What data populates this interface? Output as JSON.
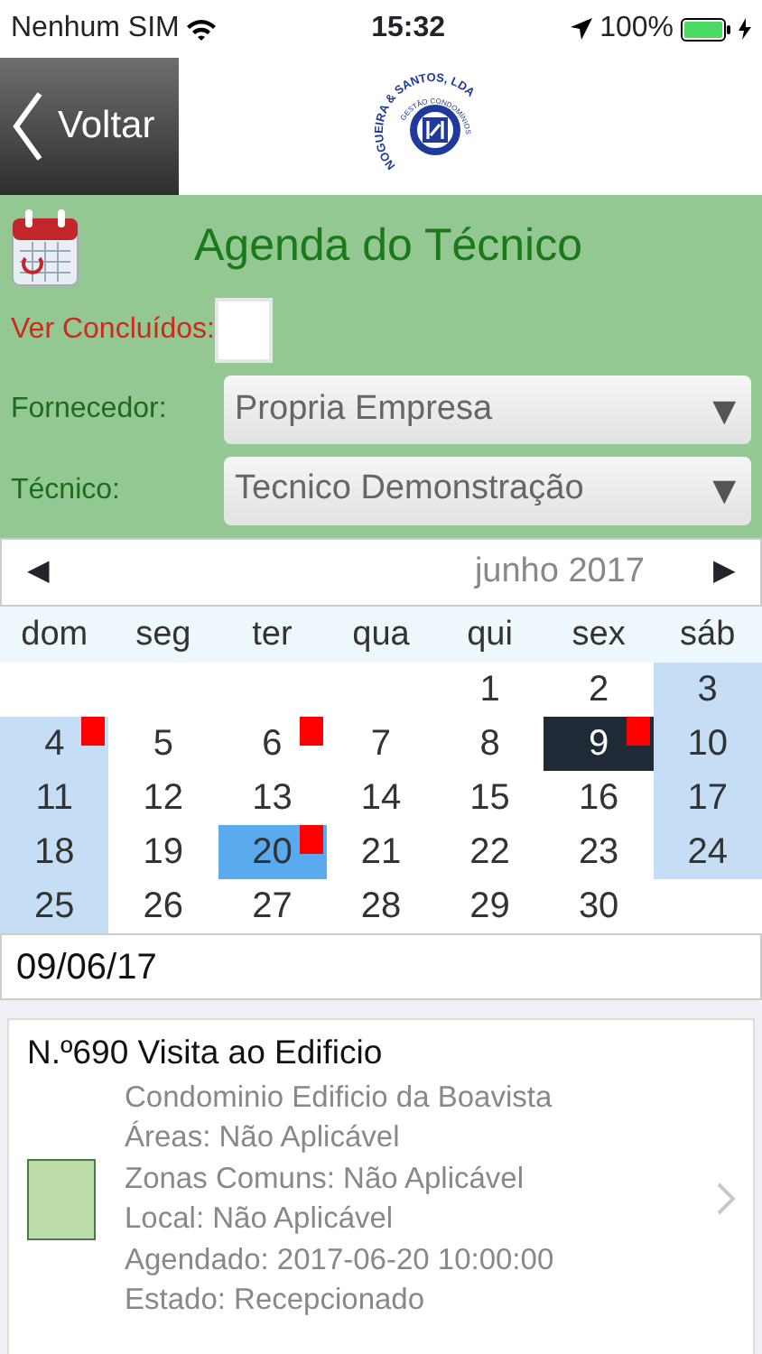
{
  "status_bar": {
    "carrier": "Nenhum SIM",
    "time": "15:32",
    "battery": "100%"
  },
  "header": {
    "back": "Voltar",
    "logo": {
      "name": "NOGUEIRA & SANTOS, LDA",
      "tagline": "GESTÃO CONDOMÍNIOS"
    }
  },
  "filters": {
    "title": "Agenda do Técnico",
    "show_done": {
      "label": "Ver Concluídos:",
      "checked": false
    },
    "selects": [
      {
        "label": "Fornecedor:",
        "value": "Propria Empresa",
        "arrow": "▼"
      },
      {
        "label": "Técnico:",
        "value": "Tecnico Demonstração",
        "arrow": "▼"
      }
    ]
  },
  "calendar": {
    "prev": "◀",
    "month": "junho 2017",
    "next": "▶",
    "weekdays": [
      "dom",
      "seg",
      "ter",
      "qua",
      "qui",
      "sex",
      "sáb"
    ],
    "weeks": [
      [
        {
          "kind": "blank"
        },
        {
          "kind": "blank"
        },
        {
          "kind": "blank"
        },
        {
          "kind": "blank"
        },
        {
          "day": "1",
          "selected": false,
          "today": false,
          "event": false
        },
        {
          "day": "2",
          "selected": false,
          "today": false,
          "event": false
        },
        {
          "day": "3",
          "selected": false,
          "today": false,
          "event": false
        }
      ],
      [
        {
          "day": "4",
          "selected": false,
          "today": false,
          "event": true
        },
        {
          "day": "5",
          "selected": false,
          "today": false,
          "event": false
        },
        {
          "day": "6",
          "selected": false,
          "today": false,
          "event": true
        },
        {
          "day": "7",
          "selected": false,
          "today": false,
          "event": false
        },
        {
          "day": "8",
          "selected": false,
          "today": false,
          "event": false
        },
        {
          "day": "9",
          "selected": true,
          "today": false,
          "event": true
        },
        {
          "day": "10",
          "selected": false,
          "today": false,
          "event": false
        }
      ],
      [
        {
          "day": "11",
          "selected": false,
          "today": false,
          "event": false
        },
        {
          "day": "12",
          "selected": false,
          "today": false,
          "event": false
        },
        {
          "day": "13",
          "selected": false,
          "today": false,
          "event": false
        },
        {
          "day": "14",
          "selected": false,
          "today": false,
          "event": false
        },
        {
          "day": "15",
          "selected": false,
          "today": false,
          "event": false
        },
        {
          "day": "16",
          "selected": false,
          "today": false,
          "event": false
        },
        {
          "day": "17",
          "selected": false,
          "today": false,
          "event": false
        }
      ],
      [
        {
          "day": "18",
          "selected": false,
          "today": false,
          "event": false
        },
        {
          "day": "19",
          "selected": false,
          "today": false,
          "event": false
        },
        {
          "day": "20",
          "selected": false,
          "today": true,
          "event": true
        },
        {
          "day": "21",
          "selected": false,
          "today": false,
          "event": false
        },
        {
          "day": "22",
          "selected": false,
          "today": false,
          "event": false
        },
        {
          "day": "23",
          "selected": false,
          "today": false,
          "event": false
        },
        {
          "day": "24",
          "selected": false,
          "today": false,
          "event": false
        }
      ],
      [
        {
          "day": "25",
          "selected": false,
          "today": false,
          "event": false
        },
        {
          "day": "26",
          "selected": false,
          "today": false,
          "event": false
        },
        {
          "day": "27",
          "selected": false,
          "today": false,
          "event": false
        },
        {
          "day": "28",
          "selected": false,
          "today": false,
          "event": false
        },
        {
          "day": "29",
          "selected": false,
          "today": false,
          "event": false
        },
        {
          "day": "30",
          "selected": false,
          "today": false,
          "event": false
        },
        {
          "kind": "blank"
        }
      ]
    ],
    "date_field": "09/06/17"
  },
  "tasks": [
    {
      "title": "N.º690 Visita ao Edificio",
      "color": "#bcdcaa",
      "lines": [
        "Condominio Edificio da Boavista",
        "Áreas: Não Aplicável",
        "Zonas Comuns: Não Aplicável",
        "Local: Não Aplicável",
        "Agendado: 2017-06-20 10:00:00",
        "Estado: Recepcionado"
      ]
    }
  ]
}
